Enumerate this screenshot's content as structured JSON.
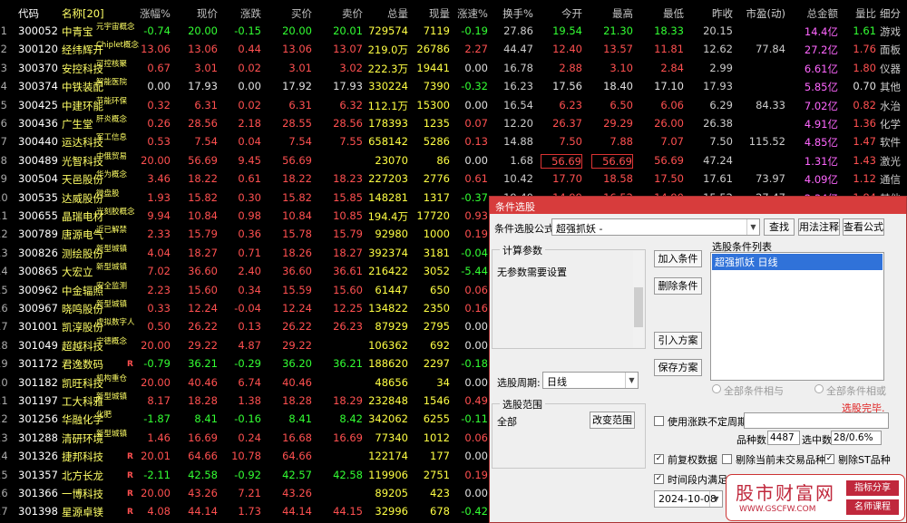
{
  "header": {
    "code": "代码",
    "name": "名称[20]",
    "pct": "涨幅%",
    "price": "现价",
    "change": "涨跌",
    "bid": "买价",
    "ask": "卖价",
    "volume": "总量",
    "cur_vol": "现量",
    "speed": "涨速%",
    "turnover": "换手%",
    "open": "今开",
    "high": "最高",
    "low": "最低",
    "prev": "昨收",
    "pe": "市盈(动)",
    "amount": "总金额",
    "vol_ratio": "量比",
    "industry": "细分"
  },
  "rows": [
    {
      "idx": "1",
      "code": "300052",
      "name": "中青宝",
      "tag": "元宇宙概念",
      "flag": "",
      "pct": "-0.74",
      "price": "20.00",
      "change": "-0.15",
      "bid": "20.00",
      "ask": "20.01",
      "volume": "729574",
      "cur": "7119",
      "speed": "-0.19",
      "turn": "27.86",
      "open": "19.54",
      "high": "21.30",
      "low": "18.33",
      "prev": "20.15",
      "pe": "",
      "amount": "14.4亿",
      "ratio": "1.61",
      "ind": "游戏",
      "dir": "dn"
    },
    {
      "idx": "2",
      "code": "300120",
      "name": "经纬辉开",
      "tag": "Chiplet概念",
      "flag": "",
      "pct": "13.06",
      "price": "13.06",
      "change": "0.44",
      "bid": "13.06",
      "ask": "13.07",
      "volume": "219.0万",
      "cur": "26786",
      "speed": "2.27",
      "turn": "44.47",
      "open": "12.40",
      "high": "13.57",
      "low": "11.81",
      "prev": "12.62",
      "pe": "77.84",
      "amount": "27.2亿",
      "ratio": "1.76",
      "ind": "面板",
      "dir": "up"
    },
    {
      "idx": "3",
      "code": "300370",
      "name": "安控科技",
      "tag": "可控核聚",
      "flag": "",
      "pct": "0.67",
      "price": "3.01",
      "change": "0.02",
      "bid": "3.01",
      "ask": "3.02",
      "volume": "222.3万",
      "cur": "19441",
      "speed": "0.00",
      "turn": "16.78",
      "open": "2.88",
      "high": "3.10",
      "low": "2.84",
      "prev": "2.99",
      "pe": "",
      "amount": "6.61亿",
      "ratio": "1.80",
      "ind": "仪器",
      "dir": "up"
    },
    {
      "idx": "4",
      "code": "300374",
      "name": "中铁装配",
      "tag": "智能医院",
      "flag": "",
      "pct": "0.00",
      "price": "17.93",
      "change": "0.00",
      "bid": "17.92",
      "ask": "17.93",
      "volume": "330224",
      "cur": "7390",
      "speed": "-0.32",
      "turn": "16.23",
      "open": "17.56",
      "high": "18.40",
      "low": "17.10",
      "prev": "17.93",
      "pe": "",
      "amount": "5.85亿",
      "ratio": "0.70",
      "ind": "其他",
      "dir": "eq"
    },
    {
      "idx": "5",
      "code": "300425",
      "name": "中建环能",
      "tag": "节能环保",
      "flag": "",
      "pct": "0.32",
      "price": "6.31",
      "change": "0.02",
      "bid": "6.31",
      "ask": "6.32",
      "volume": "112.1万",
      "cur": "15300",
      "speed": "0.00",
      "turn": "16.54",
      "open": "6.23",
      "high": "6.50",
      "low": "6.06",
      "prev": "6.29",
      "pe": "84.33",
      "amount": "7.02亿",
      "ratio": "0.82",
      "ind": "水治",
      "dir": "up"
    },
    {
      "idx": "6",
      "code": "300436",
      "name": "广生堂",
      "tag": "肝炎概念",
      "flag": "",
      "pct": "0.26",
      "price": "28.56",
      "change": "2.18",
      "bid": "28.55",
      "ask": "28.56",
      "volume": "178393",
      "cur": "1235",
      "speed": "0.07",
      "turn": "12.20",
      "open": "26.37",
      "high": "29.29",
      "low": "26.00",
      "prev": "26.38",
      "pe": "",
      "amount": "4.91亿",
      "ratio": "1.36",
      "ind": "化学",
      "dir": "up"
    },
    {
      "idx": "7",
      "code": "300440",
      "name": "运达科技",
      "tag": "军工信息",
      "flag": "",
      "pct": "0.53",
      "price": "7.54",
      "change": "0.04",
      "bid": "7.54",
      "ask": "7.55",
      "volume": "658142",
      "cur": "5286",
      "speed": "0.13",
      "turn": "14.88",
      "open": "7.50",
      "high": "7.88",
      "low": "7.07",
      "prev": "7.50",
      "pe": "115.52",
      "amount": "4.85亿",
      "ratio": "1.47",
      "ind": "软件",
      "dir": "up"
    },
    {
      "idx": "8",
      "code": "300489",
      "name": "光智科技",
      "tag": "中俄贸易",
      "flag": "",
      "pct": "20.00",
      "price": "56.69",
      "change": "9.45",
      "bid": "56.69",
      "ask": "",
      "volume": "23070",
      "cur": "86",
      "speed": "0.00",
      "turn": "1.68",
      "open": "56.69",
      "high": "56.69",
      "low": "56.69",
      "prev": "47.24",
      "pe": "",
      "amount": "1.31亿",
      "ratio": "1.43",
      "ind": "激光",
      "dir": "up",
      "hl": true
    },
    {
      "idx": "9",
      "code": "300504",
      "name": "天邑股份",
      "tag": "华为概念",
      "flag": "",
      "pct": "3.46",
      "price": "18.22",
      "change": "0.61",
      "bid": "18.22",
      "ask": "18.23",
      "volume": "227203",
      "cur": "2776",
      "speed": "0.61",
      "turn": "10.42",
      "open": "17.70",
      "high": "18.58",
      "low": "17.50",
      "prev": "17.61",
      "pe": "73.97",
      "amount": "4.09亿",
      "ratio": "1.12",
      "ind": "通信",
      "dir": "up"
    },
    {
      "idx": "10",
      "code": "300535",
      "name": "达威股份",
      "tag": "微盘股",
      "flag": "",
      "pct": "1.93",
      "price": "15.82",
      "change": "0.30",
      "bid": "15.82",
      "ask": "15.85",
      "volume": "148281",
      "cur": "1317",
      "speed": "-0.37",
      "turn": "19.40",
      "open": "14.99",
      "high": "16.52",
      "low": "14.90",
      "prev": "15.52",
      "pe": "27.47",
      "amount": "2.34亿",
      "ratio": "1.84",
      "ind": "其他",
      "dir": "up"
    },
    {
      "idx": "11",
      "code": "300655",
      "name": "晶瑞电材",
      "tag": "光刻胶概念",
      "flag": "",
      "pct": "9.94",
      "price": "10.84",
      "change": "0.98",
      "bid": "10.84",
      "ask": "10.85",
      "volume": "194.4万",
      "cur": "17720",
      "speed": "0.93",
      "turn": "20.47",
      "open": "9.67",
      "high": "11.60",
      "low": "9.58",
      "prev": "9.86",
      "pe": "",
      "amount": "20.2亿",
      "ratio": "1.96",
      "ind": "半导",
      "dir": "up"
    },
    {
      "idx": "12",
      "code": "300789",
      "name": "唐源电气",
      "tag": "近已解禁",
      "flag": "",
      "pct": "2.33",
      "price": "15.79",
      "change": "0.36",
      "bid": "15.78",
      "ask": "15.79",
      "volume": "92980",
      "cur": "1000",
      "speed": "0.19",
      "turn": "",
      "open": "",
      "high": "",
      "low": "",
      "prev": "",
      "pe": "",
      "amount": "",
      "ratio": "",
      "ind": "交通",
      "dir": "up"
    },
    {
      "idx": "13",
      "code": "300826",
      "name": "测绘股份",
      "tag": "新型城镇",
      "flag": "",
      "pct": "4.04",
      "price": "18.27",
      "change": "0.71",
      "bid": "18.26",
      "ask": "18.27",
      "volume": "392374",
      "cur": "3181",
      "speed": "-0.04",
      "turn": "",
      "open": "",
      "high": "",
      "low": "",
      "prev": "",
      "pe": "",
      "amount": "",
      "ratio": "",
      "ind": "建筑",
      "dir": "up"
    },
    {
      "idx": "14",
      "code": "300865",
      "name": "大宏立",
      "tag": "新型城镇",
      "flag": "",
      "pct": "7.02",
      "price": "36.60",
      "change": "2.40",
      "bid": "36.60",
      "ask": "36.61",
      "volume": "216422",
      "cur": "3052",
      "speed": "-5.44",
      "turn": "",
      "open": "",
      "high": "",
      "low": "",
      "prev": "",
      "pe": "",
      "amount": "",
      "ratio": "",
      "ind": "专用",
      "dir": "up"
    },
    {
      "idx": "15",
      "code": "300962",
      "name": "中金辐照",
      "tag": "安全监测",
      "flag": "",
      "pct": "2.23",
      "price": "15.60",
      "change": "0.34",
      "bid": "15.59",
      "ask": "15.60",
      "volume": "61447",
      "cur": "650",
      "speed": "0.06",
      "turn": "",
      "open": "",
      "high": "",
      "low": "",
      "prev": "",
      "pe": "",
      "amount": "",
      "ratio": "",
      "ind": "环保",
      "dir": "up"
    },
    {
      "idx": "16",
      "code": "300967",
      "name": "晓鸣股份",
      "tag": "新型城镇",
      "flag": "",
      "pct": "0.33",
      "price": "12.24",
      "change": "-0.04",
      "bid": "12.24",
      "ask": "12.25",
      "volume": "134822",
      "cur": "2350",
      "speed": "0.16",
      "turn": "",
      "open": "",
      "high": "",
      "low": "",
      "prev": "",
      "pe": "",
      "amount": "",
      "ratio": "",
      "ind": "养殖",
      "dir": "up"
    },
    {
      "idx": "17",
      "code": "301001",
      "name": "凯淳股份",
      "tag": "虚拟数字人",
      "flag": "",
      "pct": "0.50",
      "price": "26.22",
      "change": "0.13",
      "bid": "26.22",
      "ask": "26.23",
      "volume": "87929",
      "cur": "2795",
      "speed": "0.00",
      "turn": "",
      "open": "",
      "high": "",
      "low": "",
      "prev": "",
      "pe": "",
      "amount": "",
      "ratio": "",
      "ind": "商贸",
      "dir": "up"
    },
    {
      "idx": "18",
      "code": "301049",
      "name": "超越科技",
      "tag": "宁德概念",
      "flag": "",
      "pct": "20.00",
      "price": "29.22",
      "change": "4.87",
      "bid": "29.22",
      "ask": "",
      "volume": "106362",
      "cur": "692",
      "speed": "0.00",
      "turn": "",
      "open": "",
      "high": "",
      "low": "",
      "prev": "",
      "pe": "",
      "amount": "",
      "ratio": "",
      "ind": "环保",
      "dir": "up"
    },
    {
      "idx": "19",
      "code": "301172",
      "name": "君逸数码",
      "tag": "",
      "flag": "R",
      "pct": "-0.79",
      "price": "36.21",
      "change": "-0.29",
      "bid": "36.20",
      "ask": "36.21",
      "volume": "188620",
      "cur": "2297",
      "speed": "-0.18",
      "turn": "",
      "open": "",
      "high": "",
      "low": "",
      "prev": "",
      "pe": "",
      "amount": "",
      "ratio": "",
      "ind": "软件",
      "dir": "dn"
    },
    {
      "idx": "20",
      "code": "301182",
      "name": "凯旺科技",
      "tag": "机构重仓",
      "flag": "",
      "pct": "20.00",
      "price": "40.46",
      "change": "6.74",
      "bid": "40.46",
      "ask": "",
      "volume": "48656",
      "cur": "34",
      "speed": "0.00",
      "turn": "",
      "open": "",
      "high": "",
      "low": "",
      "prev": "",
      "pe": "",
      "amount": "",
      "ratio": "",
      "ind": "电器",
      "dir": "up"
    },
    {
      "idx": "21",
      "code": "301197",
      "name": "工大科雅",
      "tag": "新型城镇",
      "flag": "",
      "pct": "8.17",
      "price": "18.28",
      "change": "1.38",
      "bid": "18.28",
      "ask": "18.29",
      "volume": "232848",
      "cur": "1546",
      "speed": "0.49",
      "turn": "",
      "open": "",
      "high": "",
      "low": "",
      "prev": "",
      "pe": "",
      "amount": "",
      "ratio": "",
      "ind": "软件",
      "dir": "up"
    },
    {
      "idx": "22",
      "code": "301256",
      "name": "华融化学",
      "tag": "化肥",
      "flag": "",
      "pct": "-1.87",
      "price": "8.41",
      "change": "-0.16",
      "bid": "8.41",
      "ask": "8.42",
      "volume": "342062",
      "cur": "6255",
      "speed": "-0.11",
      "turn": "",
      "open": "",
      "high": "",
      "low": "",
      "prev": "",
      "pe": "",
      "amount": "",
      "ratio": "",
      "ind": "化工",
      "dir": "dn"
    },
    {
      "idx": "23",
      "code": "301288",
      "name": "清研环境",
      "tag": "新型城镇",
      "flag": "",
      "pct": "1.46",
      "price": "16.69",
      "change": "0.24",
      "bid": "16.68",
      "ask": "16.69",
      "volume": "77340",
      "cur": "1012",
      "speed": "0.06",
      "turn": "",
      "open": "",
      "high": "",
      "low": "",
      "prev": "",
      "pe": "",
      "amount": "",
      "ratio": "",
      "ind": "环保",
      "dir": "up"
    },
    {
      "idx": "24",
      "code": "301326",
      "name": "捷邦科技",
      "tag": "",
      "flag": "R",
      "pct": "20.01",
      "price": "64.66",
      "change": "10.78",
      "bid": "64.66",
      "ask": "",
      "volume": "122174",
      "cur": "177",
      "speed": "0.00",
      "turn": "",
      "open": "",
      "high": "",
      "low": "",
      "prev": "",
      "pe": "",
      "amount": "",
      "ratio": "",
      "ind": "电子",
      "dir": "up"
    },
    {
      "idx": "25",
      "code": "301357",
      "name": "北方长龙",
      "tag": "",
      "flag": "R",
      "pct": "-2.11",
      "price": "42.58",
      "change": "-0.92",
      "bid": "42.57",
      "ask": "42.58",
      "volume": "119906",
      "cur": "2751",
      "speed": "0.19",
      "turn": "",
      "open": "",
      "high": "",
      "low": "",
      "prev": "",
      "pe": "",
      "amount": "",
      "ratio": "",
      "ind": "军工",
      "dir": "dn"
    },
    {
      "idx": "26",
      "code": "301366",
      "name": "一博科技",
      "tag": "",
      "flag": "R",
      "pct": "20.00",
      "price": "43.26",
      "change": "7.21",
      "bid": "43.26",
      "ask": "",
      "volume": "89205",
      "cur": "423",
      "speed": "0.00",
      "turn": "",
      "open": "",
      "high": "",
      "low": "",
      "prev": "",
      "pe": "",
      "amount": "",
      "ratio": "",
      "ind": "电子",
      "dir": "up"
    },
    {
      "idx": "27",
      "code": "301398",
      "name": "星源卓镁",
      "tag": "",
      "flag": "R",
      "pct": "4.08",
      "price": "44.14",
      "change": "1.73",
      "bid": "44.14",
      "ask": "44.15",
      "volume": "32996",
      "cur": "678",
      "speed": "-0.42",
      "turn": "",
      "open": "",
      "high": "",
      "low": "",
      "prev": "",
      "pe": "",
      "amount": "",
      "ratio": "",
      "ind": "汽配",
      "dir": "up"
    },
    {
      "idx": "28",
      "code": "301508",
      "name": "中机认检",
      "tag": "",
      "flag": "R",
      "pct": "3.55",
      "price": "38.25",
      "change": "1.31",
      "bid": "38.24",
      "ask": "38.25",
      "volume": "94050",
      "cur": "1222",
      "speed": "0.03",
      "turn": "",
      "open": "",
      "high": "",
      "low": "",
      "prev": "",
      "pe": "",
      "amount": "",
      "ratio": "",
      "ind": "检测",
      "dir": "up"
    }
  ],
  "dialog": {
    "title": "条件选股",
    "formula_label": "条件选股公式",
    "formula_value": "超强抓妖  -",
    "find_btn": "查找",
    "usage_btn": "用法注释",
    "view_btn": "查看公式",
    "params_title": "计算参数",
    "params_text": "无参数需要设置",
    "add_btn": "加入条件",
    "del_btn": "删除条件",
    "import_btn": "引入方案",
    "save_btn": "保存方案",
    "list_title": "选股条件列表",
    "list_items": [
      "超强抓妖  日线"
    ],
    "period_label": "选股周期:",
    "period_value": "日线",
    "all_and": "全部条件相与",
    "all_or": "全部条件相或",
    "range_title": "选股范围",
    "range_value": "全部",
    "range_btn": "改变范围",
    "status": "选股完毕.",
    "varperiod_label": "使用涨跌不定周期",
    "count_label": "品种数",
    "count_value": "4487",
    "selected_label": "选中数",
    "selected_value": "28/0.6%",
    "prefq_label": "前复权数据",
    "exclude_untraded": "剔除当前未交易品种",
    "exclude_st": "剔除ST品种",
    "timerange_label": "时间段内满足条",
    "date_value": "2024-10-08"
  },
  "watermark": {
    "brand": "股市财富网",
    "url": "WWW.GSCFW.COM",
    "tag1": "指标分享",
    "tag2": "名师课程"
  },
  "colors": {
    "up": "#ff5050",
    "down": "#33ff33",
    "dialog_title": "#d73c3c",
    "list_select": "#3072d9"
  }
}
